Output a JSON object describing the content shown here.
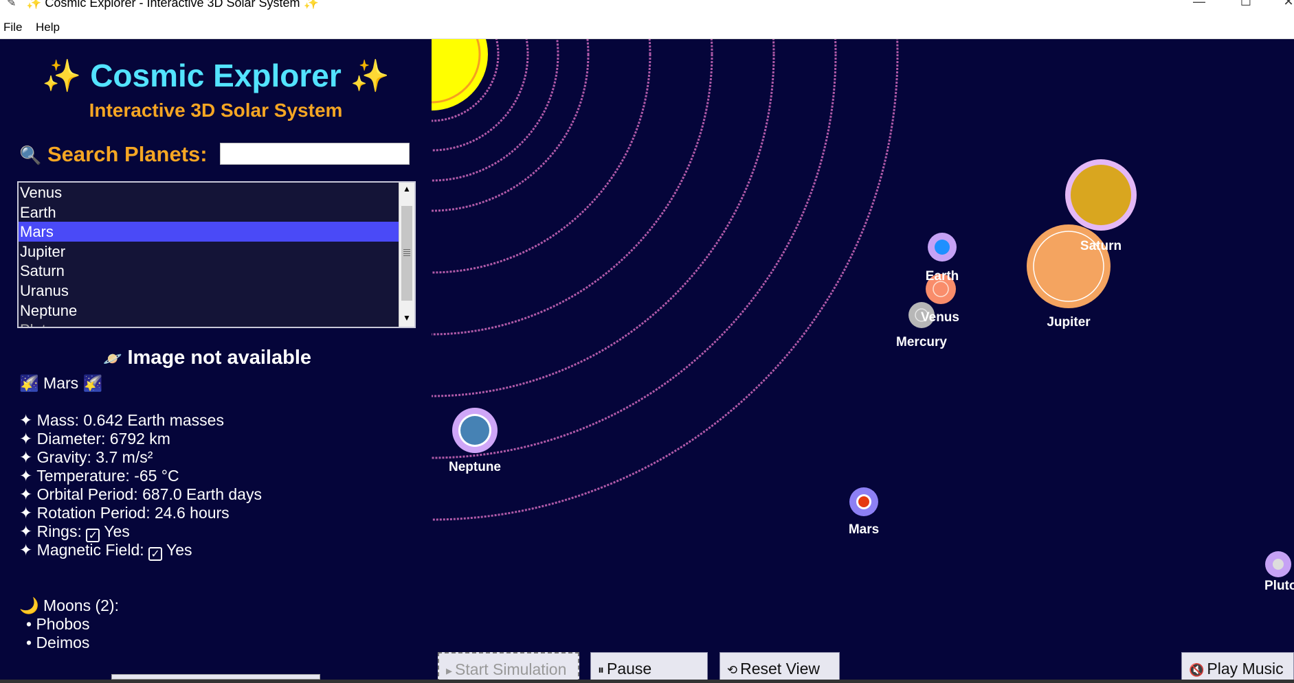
{
  "window": {
    "title": "✨ Cosmic Explorer - Interactive 3D Solar System ✨",
    "minimize": "—",
    "maximize": "☐",
    "close": "✕"
  },
  "menu": {
    "file": "File",
    "help": "Help"
  },
  "sidebar": {
    "title_spark": "✨",
    "title": "Cosmic Explorer",
    "subtitle": "Interactive 3D Solar System",
    "search_icon": "🔍",
    "search_label": "Search Planets:",
    "search_value": "",
    "list_items": [
      "Venus",
      "Earth",
      "Mars",
      "Jupiter",
      "Saturn",
      "Uranus",
      "Neptune",
      "Pluto"
    ],
    "selected_item": "Mars",
    "image_icon": "🪐",
    "image_text": "Image not available",
    "name_icon": "🌠",
    "planet_name": "Mars",
    "bullet": "✦",
    "facts": {
      "mass": "Mass: 0.642 Earth masses",
      "diameter": "Diameter: 6792 km",
      "gravity": "Gravity: 3.7 m/s²",
      "temperature": "Temperature: -65 °C",
      "orbital_period": "Orbital Period: 687.0 Earth days",
      "rotation_period": "Rotation Period: 24.6 hours",
      "rings_label": "Rings:",
      "rings_value": "Yes",
      "magnetic_label": "Magnetic Field:",
      "magnetic_value": "Yes",
      "check_glyph": "✓"
    },
    "moons_icon": "🌙",
    "moons_title": "Moons (2):",
    "moons": [
      "• Phobos",
      "• Deimos"
    ]
  },
  "canvas": {
    "labels": {
      "saturn": "Saturn",
      "earth": "Earth",
      "venus": "Venus",
      "jupiter": "Jupiter",
      "mercury": "Mercury",
      "neptune": "Neptune",
      "mars": "Mars",
      "pluto": "Pluto"
    }
  },
  "buttons": {
    "start": "Start Simulation",
    "start_icon": "▸",
    "pause": "Pause",
    "pause_icon": "⏸",
    "reset": "Reset View",
    "reset_icon": "⟲",
    "music": "Play Music",
    "music_icon": "🔇"
  },
  "colors": {
    "background": "#05053a",
    "title": "#53e3ff",
    "subtitle": "#f5a623",
    "selection": "#4a4af7",
    "orbit": "#b05aa8"
  }
}
